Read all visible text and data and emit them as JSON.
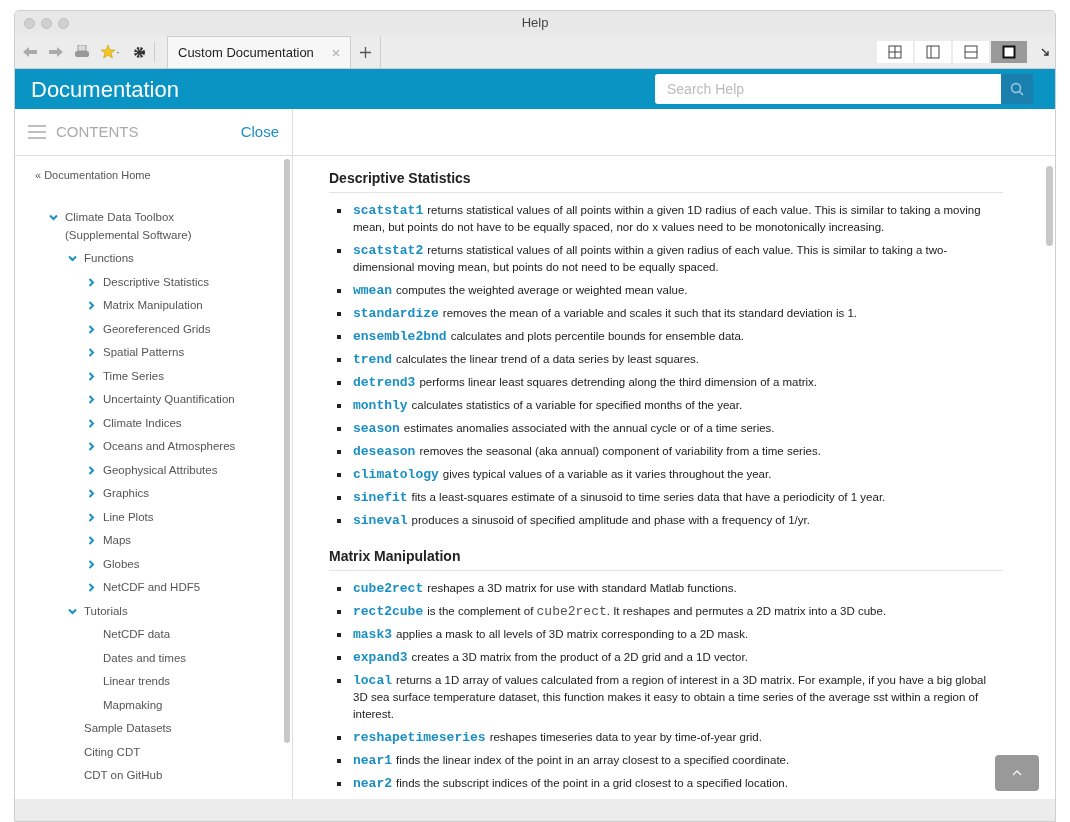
{
  "window": {
    "title": "Help"
  },
  "toolbar": {
    "tabs": [
      {
        "label": "Custom Documentation",
        "selected": true
      }
    ],
    "layouts": [
      {
        "selected": false
      },
      {
        "selected": false
      },
      {
        "selected": false
      },
      {
        "selected": true
      }
    ]
  },
  "header": {
    "title": "Documentation",
    "search": {
      "placeholder": "Search Help"
    }
  },
  "contents_bar": {
    "label": "CONTENTS",
    "close": "Close"
  },
  "sidebar": {
    "home": "« Documentation Home",
    "tree": [
      {
        "label": "Climate Data Toolbox (Supplemental Software)",
        "expanded": true,
        "children": [
          {
            "label": "Functions",
            "expanded": true,
            "children": [
              {
                "label": "Descriptive Statistics",
                "expanded": false
              },
              {
                "label": "Matrix Manipulation",
                "expanded": false
              },
              {
                "label": "Georeferenced Grids",
                "expanded": false
              },
              {
                "label": "Spatial Patterns",
                "expanded": false
              },
              {
                "label": "Time Series",
                "expanded": false
              },
              {
                "label": "Uncertainty Quantification",
                "expanded": false
              },
              {
                "label": "Climate Indices",
                "expanded": false
              },
              {
                "label": "Oceans and Atmospheres",
                "expanded": false
              },
              {
                "label": "Geophysical Attributes",
                "expanded": false
              },
              {
                "label": "Graphics",
                "expanded": false
              },
              {
                "label": "Line Plots",
                "expanded": false
              },
              {
                "label": "Maps",
                "expanded": false
              },
              {
                "label": "Globes",
                "expanded": false
              },
              {
                "label": "NetCDF and HDF5",
                "expanded": false
              }
            ]
          },
          {
            "label": "Tutorials",
            "expanded": true,
            "children": [
              {
                "label": "NetCDF data"
              },
              {
                "label": "Dates and times"
              },
              {
                "label": "Linear trends"
              },
              {
                "label": "Mapmaking"
              }
            ]
          },
          {
            "label": "Sample Datasets"
          },
          {
            "label": "Citing CDT"
          },
          {
            "label": "CDT on GitHub"
          }
        ]
      }
    ]
  },
  "sections": [
    {
      "heading": "Descriptive Statistics",
      "items": [
        {
          "name": "scatstat1",
          "description": [
            {
              "kind": "text",
              "text": "returns statistical values of all points within a given 1D radius of each value. This is similar to taking a moving mean, but points do not have to be equally spaced, nor do x values need to be monotonically increasing."
            }
          ]
        },
        {
          "name": "scatstat2",
          "description": [
            {
              "kind": "text",
              "text": "returns statistical values of all points within a given radius of each value. This is similar to taking a two-dimensional moving mean, but points do not need to be equally spaced."
            }
          ]
        },
        {
          "name": "wmean",
          "description": [
            {
              "kind": "text",
              "text": "computes the weighted average or weighted mean value."
            }
          ]
        },
        {
          "name": "standardize",
          "description": [
            {
              "kind": "text",
              "text": "removes the mean of a variable and scales it such that its standard deviation is 1."
            }
          ]
        },
        {
          "name": "ensemble2bnd",
          "description": [
            {
              "kind": "text",
              "text": "calculates and plots percentile bounds for ensemble data."
            }
          ]
        },
        {
          "name": "trend",
          "description": [
            {
              "kind": "text",
              "text": "calculates the linear trend of a data series by least squares."
            }
          ]
        },
        {
          "name": "detrend3",
          "description": [
            {
              "kind": "text",
              "text": "performs linear least squares detrending along the third dimension of a matrix."
            }
          ]
        },
        {
          "name": "monthly",
          "description": [
            {
              "kind": "text",
              "text": "calculates statistics of a variable for specified months of the year."
            }
          ]
        },
        {
          "name": "season",
          "description": [
            {
              "kind": "text",
              "text": "estimates anomalies associated with the annual cycle or of a time series."
            }
          ]
        },
        {
          "name": "deseason",
          "description": [
            {
              "kind": "text",
              "text": "removes the seasonal (aka annual) component of variability from a time series."
            }
          ]
        },
        {
          "name": "climatology",
          "description": [
            {
              "kind": "text",
              "text": "gives typical values of a variable as it varies throughout the year."
            }
          ]
        },
        {
          "name": "sinefit",
          "description": [
            {
              "kind": "text",
              "text": "fits a least-squares estimate of a sinusoid to time series data that have a periodicity of 1 year."
            }
          ]
        },
        {
          "name": "sineval",
          "description": [
            {
              "kind": "text",
              "text": "produces a sinusoid of specified amplitude and phase with a frequency of 1/yr."
            }
          ]
        }
      ]
    },
    {
      "heading": "Matrix Manipulation",
      "items": [
        {
          "name": "cube2rect",
          "description": [
            {
              "kind": "text",
              "text": "reshapes a 3D matrix for use with standard Matlab functions."
            }
          ]
        },
        {
          "name": "rect2cube",
          "description": [
            {
              "kind": "text",
              "text": "is the complement of "
            },
            {
              "kind": "code",
              "text": "cube2rect"
            },
            {
              "kind": "text",
              "text": ". It reshapes and permutes a 2D matrix into a 3D cube."
            }
          ]
        },
        {
          "name": "mask3",
          "description": [
            {
              "kind": "text",
              "text": "applies a mask to all levels of 3D matrix corresponding to a 2D mask."
            }
          ]
        },
        {
          "name": "expand3",
          "description": [
            {
              "kind": "text",
              "text": "creates a 3D matrix from the product of a 2D grid and a 1D vector."
            }
          ]
        },
        {
          "name": "local",
          "description": [
            {
              "kind": "text",
              "text": "returns a 1D array of values calculated from a region of interest in a 3D matrix. For example, if you have a big global 3D sea surface temperature dataset, this function makes it easy to obtain a time series of the average sst within a region of interest."
            }
          ]
        },
        {
          "name": "reshapetimeseries",
          "description": [
            {
              "kind": "text",
              "text": "reshapes timeseries data to year by time-of-year grid."
            }
          ]
        },
        {
          "name": "near1",
          "description": [
            {
              "kind": "text",
              "text": "finds the linear index of the point in an array closest to a specified coordinate."
            }
          ]
        },
        {
          "name": "near2",
          "description": [
            {
              "kind": "text",
              "text": "finds the subscript indices of the point in a grid closest to a specified location."
            }
          ]
        }
      ]
    }
  ]
}
